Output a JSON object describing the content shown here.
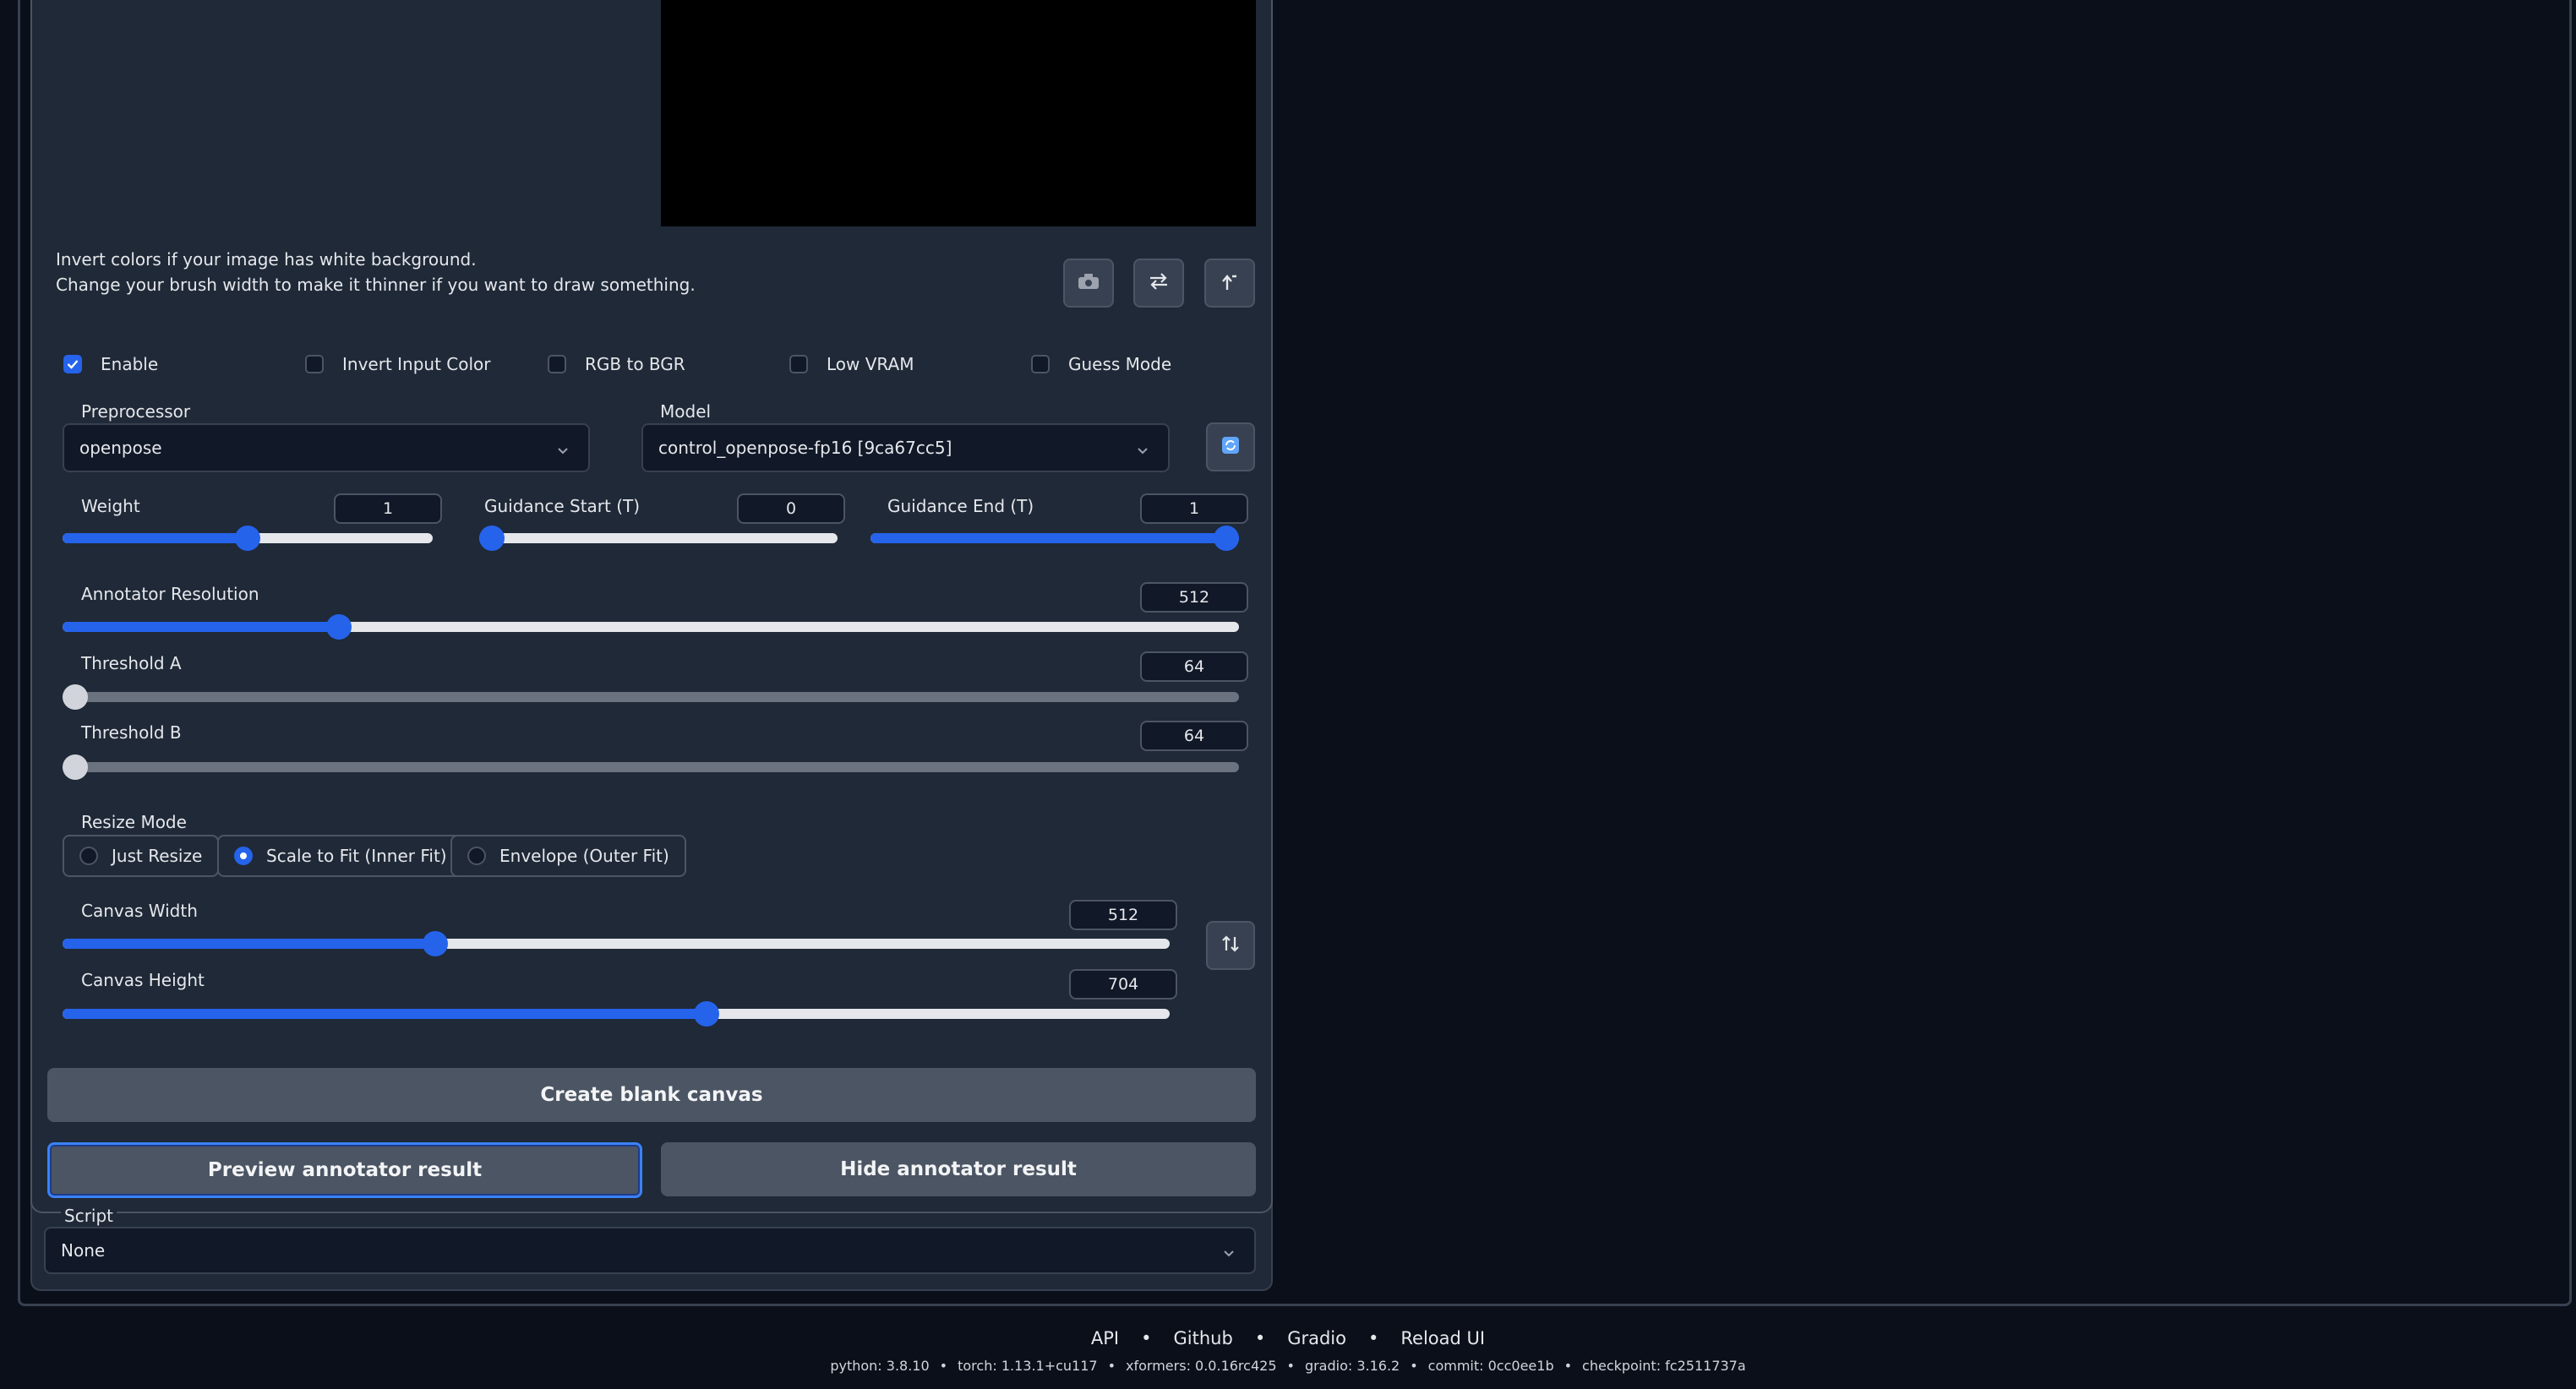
{
  "hints": {
    "line1": "Invert colors if your image has white background.",
    "line2": "Change your brush width to make it thinner if you want to draw something."
  },
  "icons": {
    "camera": "camera-icon",
    "swap": "swap-icon",
    "send": "send-dimensions-icon",
    "refresh": "refresh-icon",
    "swap_vertical": "swap-vertical-icon"
  },
  "checkboxes": [
    {
      "label": "Enable",
      "checked": true
    },
    {
      "label": "Invert Input Color",
      "checked": false
    },
    {
      "label": "RGB to BGR",
      "checked": false
    },
    {
      "label": "Low VRAM",
      "checked": false
    },
    {
      "label": "Guess Mode",
      "checked": false
    }
  ],
  "preprocessor": {
    "label": "Preprocessor",
    "value": "openpose"
  },
  "model": {
    "label": "Model",
    "value": "control_openpose-fp16 [9ca67cc5]"
  },
  "sliders": {
    "weight": {
      "label": "Weight",
      "value": "1",
      "fraction": 0.5
    },
    "guidance_start": {
      "label": "Guidance Start (T)",
      "value": "0",
      "fraction": 0.0
    },
    "guidance_end": {
      "label": "Guidance End (T)",
      "value": "1",
      "fraction": 1.0
    },
    "annotator_resolution": {
      "label": "Annotator Resolution",
      "value": "512",
      "fraction": 0.235
    },
    "threshold_a": {
      "label": "Threshold A",
      "value": "64",
      "fraction": 0.0
    },
    "threshold_b": {
      "label": "Threshold B",
      "value": "64",
      "fraction": 0.0
    },
    "canvas_width": {
      "label": "Canvas Width",
      "value": "512",
      "fraction": 0.337
    },
    "canvas_height": {
      "label": "Canvas Height",
      "value": "704",
      "fraction": 0.582
    }
  },
  "resize_mode": {
    "label": "Resize Mode",
    "options": [
      "Just Resize",
      "Scale to Fit (Inner Fit)",
      "Envelope (Outer Fit)"
    ],
    "selected": "Scale to Fit (Inner Fit)"
  },
  "buttons": {
    "create_blank_canvas": "Create blank canvas",
    "preview_annotator": "Preview annotator result",
    "hide_annotator": "Hide annotator result"
  },
  "script": {
    "label": "Script",
    "value": "None"
  },
  "footer": {
    "links": [
      "API",
      "Github",
      "Gradio",
      "Reload UI"
    ],
    "info": [
      "python: 3.8.10",
      "torch: 1.13.1+cu117",
      "xformers: 0.0.16rc425",
      "gradio: 3.16.2",
      "commit: 0cc0ee1b",
      "checkpoint: fc2511737a"
    ]
  },
  "colors": {
    "accent": "#2563eb",
    "panel": "#1f2937",
    "background": "#0b0f19"
  }
}
